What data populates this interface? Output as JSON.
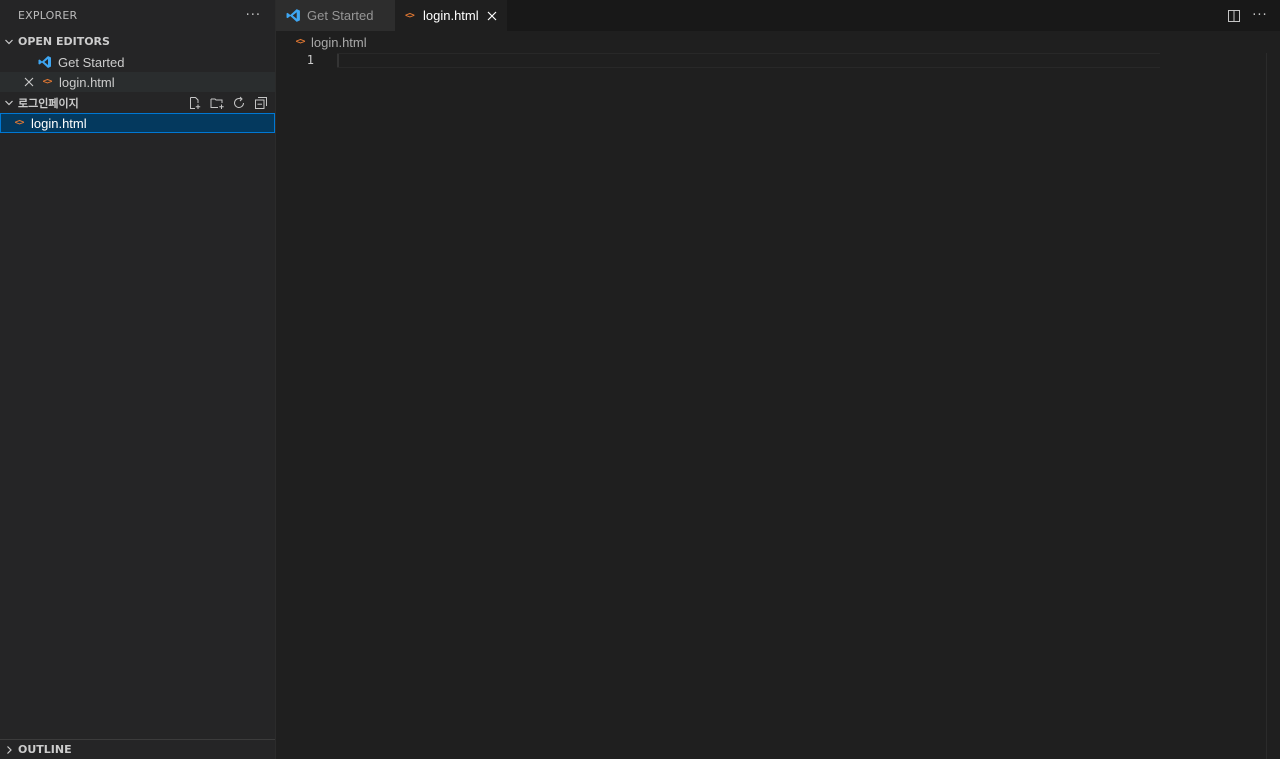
{
  "sidebar": {
    "title": "EXPLORER",
    "more_label": "···",
    "open_editors": {
      "label": "OPEN EDITORS",
      "items": [
        {
          "label": "Get Started",
          "icon": "vscode-icon"
        },
        {
          "label": "login.html",
          "icon": "html-file-icon"
        }
      ]
    },
    "folder": {
      "label": "로그인페이지",
      "actions": [
        "new-file-icon",
        "new-folder-icon",
        "refresh-icon",
        "collapse-all-icon"
      ],
      "files": [
        {
          "label": "login.html",
          "icon": "html-file-icon"
        }
      ]
    },
    "outline": {
      "label": "OUTLINE"
    }
  },
  "html_icon_glyph": "<>",
  "tabs": [
    {
      "label": "Get Started",
      "active": false,
      "icon": "vscode-icon"
    },
    {
      "label": "login.html",
      "active": true,
      "icon": "html-file-icon"
    }
  ],
  "tab_more_label": "···",
  "breadcrumb": {
    "file": "login.html"
  },
  "editor": {
    "line_numbers": [
      "1"
    ]
  },
  "colors": {
    "accent": "#0078d4",
    "html_icon": "#e37933",
    "vscode_blue": "#3ea6f2"
  }
}
